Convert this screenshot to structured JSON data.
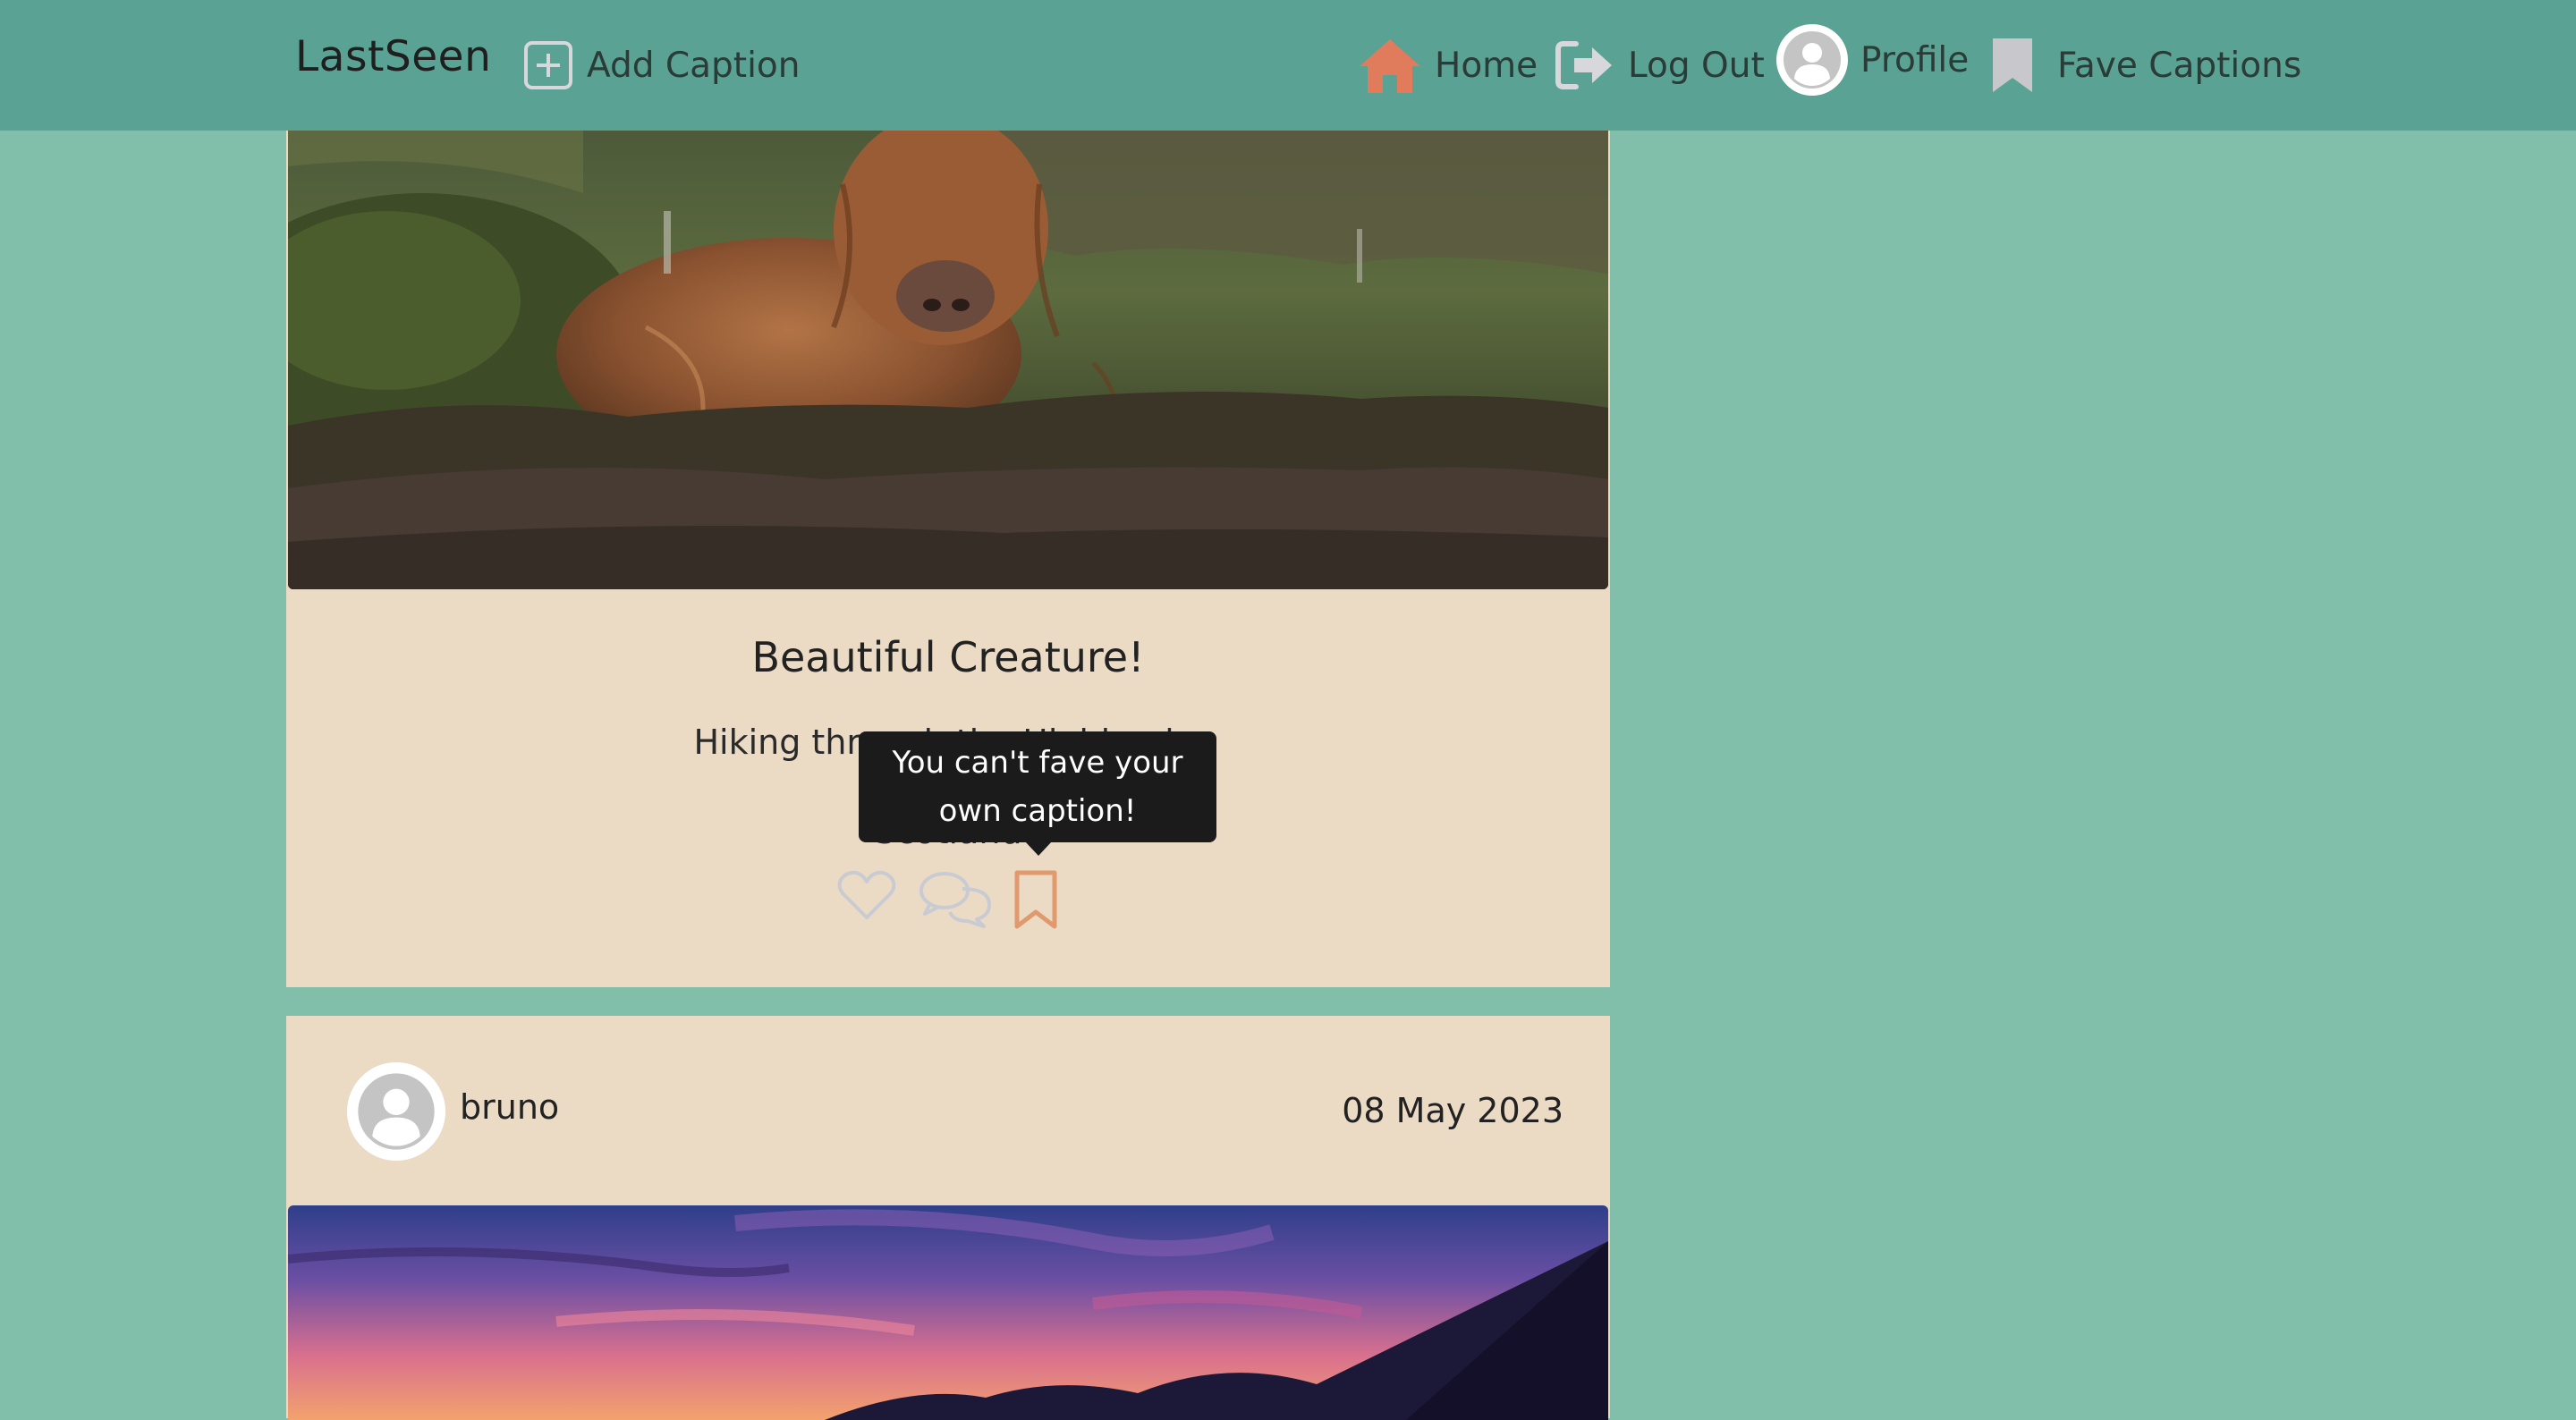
{
  "navbar": {
    "brand": "LastSeen",
    "add_caption": "Add Caption",
    "home": "Home",
    "logout": "Log Out",
    "profile": "Profile",
    "fave_captions": "Fave Captions",
    "icons": [
      "plus-square-icon",
      "home-icon",
      "logout-icon",
      "avatar-icon",
      "bookmark-icon"
    ],
    "colors": {
      "bar": "#5aa293",
      "home_icon": "#e07b5c",
      "bookmark_icon": "#c8c8cc"
    }
  },
  "posts": [
    {
      "title": "Beautiful Creature!",
      "description": "Hiking through the Highlands,",
      "location": "Scotland",
      "image": "highland-cow-photo",
      "actions": [
        "heart-icon",
        "comments-icon",
        "bookmark-icon"
      ],
      "tooltip": "You can't fave your own caption!"
    },
    {
      "author": "bruno",
      "date": "08 May 2023",
      "image": "sunset-mountains-photo"
    }
  ],
  "colors": {
    "page_bg": "#82bfab",
    "card_bg": "#ecdbc4",
    "tooltip_bg": "#1b1b1b",
    "fave_accent": "#e09a6e"
  }
}
